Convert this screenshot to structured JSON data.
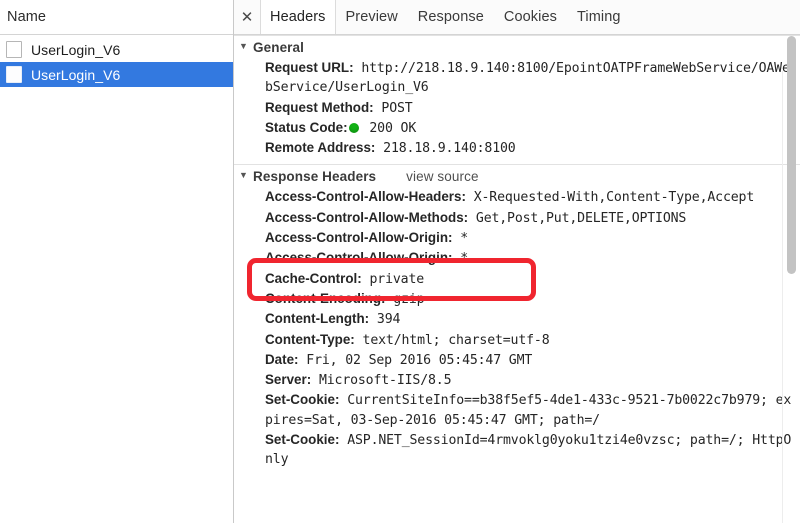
{
  "sidebar": {
    "column_header": "Name",
    "rows": [
      {
        "label": "UserLogin_V6",
        "selected": false,
        "icon": "document-icon"
      },
      {
        "label": "UserLogin_V6",
        "selected": true,
        "icon": "document-icon"
      }
    ]
  },
  "tabbar": {
    "close_label": "✕",
    "tabs": [
      {
        "label": "Headers",
        "active": true
      },
      {
        "label": "Preview",
        "active": false
      },
      {
        "label": "Response",
        "active": false
      },
      {
        "label": "Cookies",
        "active": false
      },
      {
        "label": "Timing",
        "active": false
      }
    ]
  },
  "general": {
    "title": "General",
    "triangle": "▼",
    "rows": [
      {
        "name": "Request URL:",
        "value": " http://218.18.9.140:8100/EpointOATPFrameWebService/OAWebService/UserLogin_V6"
      },
      {
        "name": "Request Method:",
        "value": " POST"
      },
      {
        "name": "Status Code:",
        "value": " 200 OK",
        "status_dot": true,
        "dot_color": "#13b315"
      },
      {
        "name": "Remote Address:",
        "value": " 218.18.9.140:8100"
      }
    ]
  },
  "response_headers": {
    "title": "Response Headers",
    "triangle": "▼",
    "view_source": "view source",
    "rows": [
      {
        "name": "Access-Control-Allow-Headers:",
        "value": " X-Requested-With,Content-Type,Accept"
      },
      {
        "name": "Access-Control-Allow-Methods:",
        "value": " Get,Post,Put,DELETE,OPTIONS"
      },
      {
        "name": "Access-Control-Allow-Origin:",
        "value": " *"
      },
      {
        "name": "Access-Control-Allow-Origin:",
        "value": " *"
      },
      {
        "name": "Cache-Control:",
        "value": " private"
      },
      {
        "name": "Content-Encoding:",
        "value": " gzip"
      },
      {
        "name": "Content-Length:",
        "value": " 394"
      },
      {
        "name": "Content-Type:",
        "value": " text/html; charset=utf-8"
      },
      {
        "name": "Date:",
        "value": " Fri, 02 Sep 2016 05:45:47 GMT"
      },
      {
        "name": "Server:",
        "value": " Microsoft-IIS/8.5"
      },
      {
        "name": "Set-Cookie:",
        "value": " CurrentSiteInfo==b38f5ef5-4de1-433c-9521-7b0022c7b979; expires=Sat, 03-Sep-2016 05:45:47 GMT; path=/"
      },
      {
        "name": "Set-Cookie:",
        "value": " ASP.NET_SessionId=4rmvoklg0yoku1tzi4e0vzsc; path=/; HttpOnly"
      }
    ]
  },
  "annotation": {
    "highlight_color": "#f0252f",
    "highlights": [
      "Access-Control-Allow-Origin: *",
      "Access-Control-Allow-Origin: *"
    ]
  },
  "scrollbar": {
    "color": "#c3c3c3"
  }
}
